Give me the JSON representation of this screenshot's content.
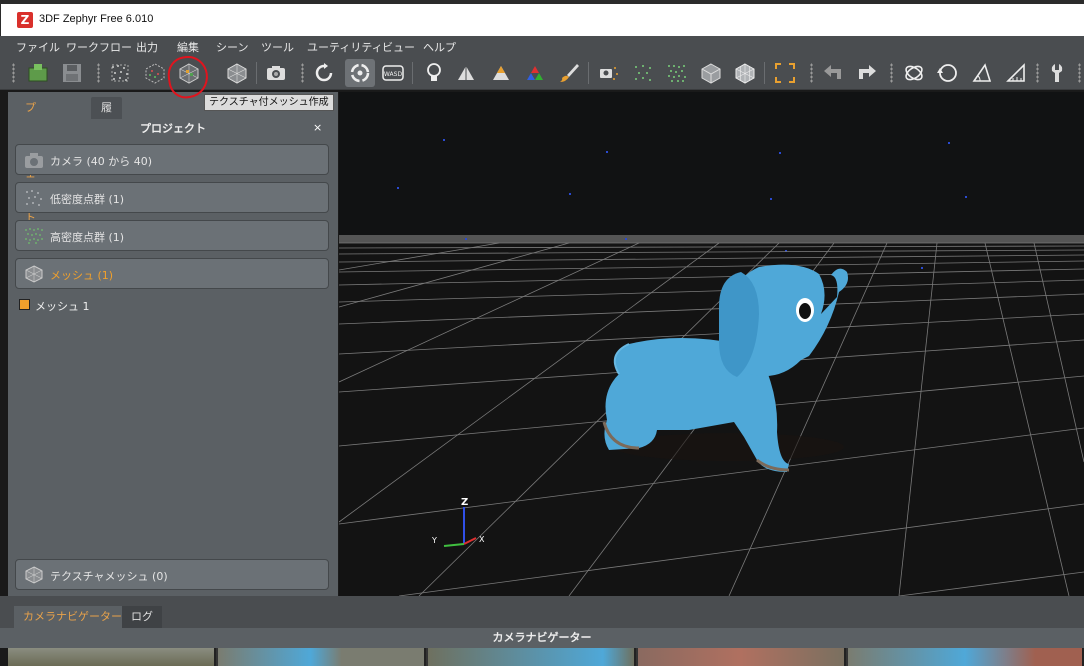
{
  "window": {
    "title": "3DF Zephyr Free 6.010",
    "app_icon": "zephyr-logo-icon"
  },
  "menu": [
    "ファイル",
    "ワークフロー",
    "出力",
    "編集",
    "シーン",
    "ツール",
    "ユーティリティ",
    "ビュー",
    "ヘルプ"
  ],
  "toolbar": {
    "tooltip": "テクスチャ付メッシュ作成",
    "buttons": [
      "new-project-icon",
      "save-icon",
      "sparse-cloud-icon",
      "dense-cloud-icon",
      "textured-mesh-icon",
      "mesh-icon",
      "camera-icon",
      "orbit-icon",
      "pivot-orbit-icon",
      "wasd-icon",
      "light-icon",
      "triangle-icon",
      "triangle-colored-icon",
      "triangle-rgb-icon",
      "brush-icon",
      "camera-points-icon",
      "points-icon",
      "points-green-icon",
      "cube-icon",
      "cube-textured-icon",
      "select-rect-icon",
      "undo-icon",
      "redo-icon",
      "gizmo-icon",
      "rotate-icon",
      "angle-icon",
      "ruler-icon",
      "wrench-icon"
    ],
    "wasd_label": "WASD"
  },
  "left_panel": {
    "tabs": [
      "プロジェクト",
      "履歴"
    ],
    "header": "プロジェクト",
    "close": "×",
    "groups": [
      {
        "label": "カメラ (40 から 40)",
        "icon": "camera-icon"
      },
      {
        "label": "低密度点群 (1)",
        "icon": "sparse-cloud-icon"
      },
      {
        "label": "高密度点群 (1)",
        "icon": "dense-cloud-icon"
      },
      {
        "label": "メッシュ (1)",
        "icon": "mesh-icon"
      }
    ],
    "mesh_item": "メッシュ 1",
    "textured_group": {
      "label": "テクスチャメッシュ (0)",
      "icon": "textured-mesh-icon"
    }
  },
  "viewport": {
    "axis_z": "Z",
    "axis_y": "Y",
    "axis_x": "X"
  },
  "bottom": {
    "tabs": [
      "カメラナビゲーター",
      "ログ"
    ],
    "header": "カメラナビゲーター"
  },
  "colors": {
    "accent": "#f0a02c",
    "panel": "#5b6064",
    "toolbar": "#4a4d50",
    "elephant": "#4fa8d8"
  }
}
